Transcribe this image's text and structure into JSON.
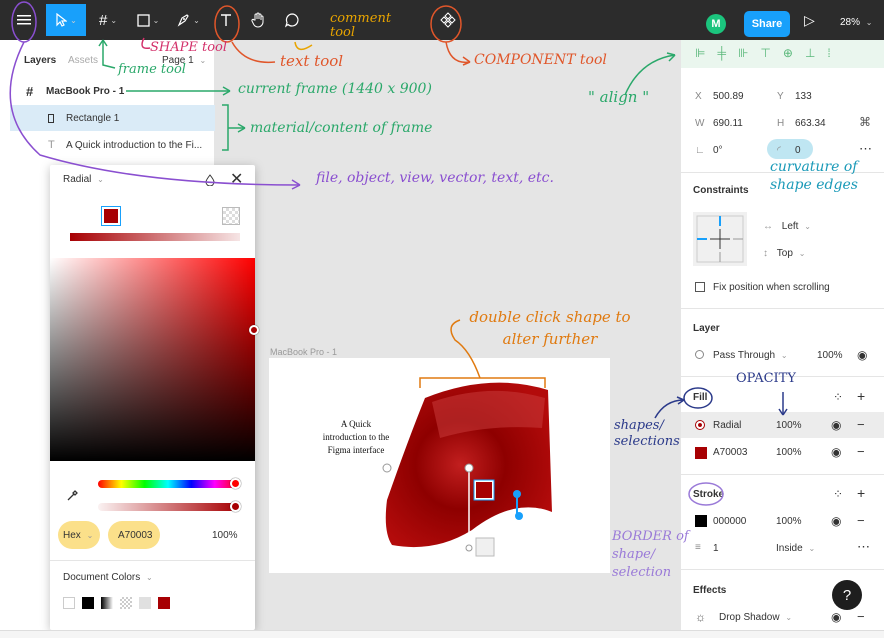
{
  "toolbar": {
    "share_label": "Share",
    "avatar_initial": "M",
    "zoom": "28%",
    "caret": "⌄"
  },
  "left_panel": {
    "tabs": [
      "Layers",
      "Assets"
    ],
    "page": "Page 1",
    "layers": [
      {
        "name": "MacBook Pro - 1",
        "icon": "frame-icon"
      },
      {
        "name": "Rectangle 1",
        "icon": "rectangle-icon"
      },
      {
        "name": "A Quick introduction to the Fi...",
        "icon": "text-icon"
      }
    ]
  },
  "color_picker": {
    "fill_type": "Radial",
    "color_mode": "Hex",
    "hex": "A70003",
    "opacity": "100%",
    "document_colors_label": "Document Colors",
    "document_colors": [
      "#ffffff",
      "#000000",
      "#666666",
      "#cccccc",
      "#e0e0e0",
      "#a70003"
    ]
  },
  "canvas": {
    "frame_label": "MacBook Pro - 1",
    "frame_text": "A Quick introduction to the Figma interface"
  },
  "right_panel": {
    "x_label": "X",
    "x": "500.89",
    "y_label": "Y",
    "y": "133",
    "w_label": "W",
    "w": "690.11",
    "h_label": "H",
    "h": "663.34",
    "rotation": "0°",
    "radius": "0",
    "constraints_title": "Constraints",
    "constraint_h": "Left",
    "constraint_v": "Top",
    "fix_position": "Fix position when scrolling",
    "layer_title": "Layer",
    "blend_mode": "Pass Through",
    "layer_opacity": "100%",
    "fill_title": "Fill",
    "fills": [
      {
        "name": "Radial",
        "opacity": "100%",
        "color": "#a70003"
      },
      {
        "name": "A70003",
        "opacity": "100%",
        "color": "#a70003"
      }
    ],
    "stroke_title": "Stroke",
    "stroke_color_hex": "000000",
    "stroke_opacity": "100%",
    "stroke_weight": "1",
    "stroke_position": "Inside",
    "effects_title": "Effects",
    "effect_name": "Drop Shadow",
    "help": "?"
  },
  "annotations": {
    "shape_tool": "SHAPE tool",
    "frame_tool": "frame tool",
    "text_tool": "text tool",
    "comment_tool": "comment tool",
    "component_tool": "COMPONENT tool",
    "align": "\" align \"",
    "current_frame": "current frame (1440 x 900)",
    "material": "material/content of frame",
    "file_menu": "file, object, view, vector, text, etc.",
    "curvature": "curvature of shape edges",
    "double_click": "double click shape to alter further",
    "opacity": "OPACITY",
    "shapes_selections": "shapes/ selections",
    "border": "BORDER of shape/ selection"
  },
  "colors": {
    "accent": "#18a0fb",
    "fill": "#a70003",
    "toolbar": "#2c2c2c"
  }
}
